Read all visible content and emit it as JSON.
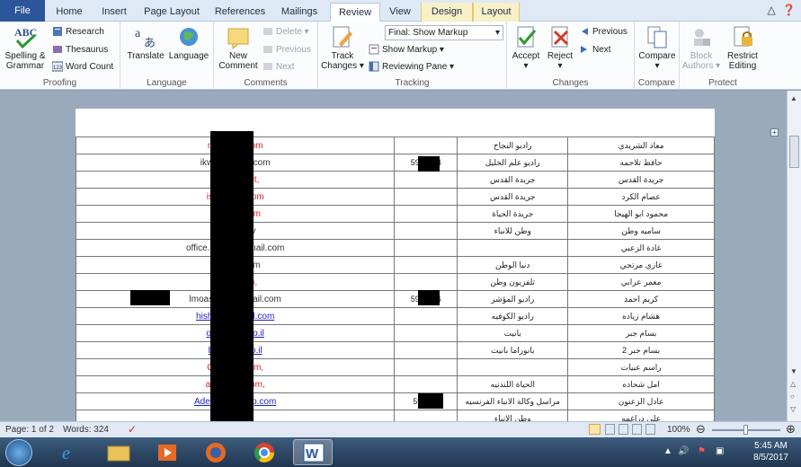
{
  "tabs": {
    "file": "File",
    "home": "Home",
    "insert": "Insert",
    "page_layout": "Page Layout",
    "references": "References",
    "mailings": "Mailings",
    "review": "Review",
    "view": "View",
    "design": "Design",
    "layout": "Layout"
  },
  "ribbon": {
    "proofing": {
      "label": "Proofing",
      "spelling_line1": "Spelling &",
      "spelling_line2": "Grammar",
      "research": "Research",
      "thesaurus": "Thesaurus",
      "word_count": "Word Count"
    },
    "language": {
      "label": "Language",
      "translate": "Translate",
      "language": "Language"
    },
    "comments": {
      "label": "Comments",
      "new_line1": "New",
      "new_line2": "Comment",
      "delete": "Delete",
      "previous": "Previous",
      "next": "Next"
    },
    "tracking": {
      "label": "Tracking",
      "track_line1": "Track",
      "track_line2": "Changes",
      "markup_mode": "Final: Show Markup",
      "show_markup": "Show Markup",
      "reviewing_pane": "Reviewing Pane"
    },
    "changes": {
      "label": "Changes",
      "accept": "Accept",
      "reject": "Reject",
      "previous": "Previous",
      "next": "Next"
    },
    "compare": {
      "label": "Compare",
      "compare": "Compare"
    },
    "protect": {
      "label": "Protect",
      "block_line1": "Block",
      "block_line2": "Authors",
      "restrict_line1": "Restrict",
      "restrict_line2": "Editing"
    }
  },
  "table_rows": [
    {
      "email": "moaz…o.com",
      "email_style": "red",
      "phone": "",
      "org": "راديو النجاح",
      "name": "معاذ الشريدي"
    },
    {
      "email": "ikwani…mail.com",
      "email_style": "dark",
      "phone": "59…334",
      "org": "راديو علم الخليل",
      "name": "حافظ تلاحمه"
    },
    {
      "email": "alqu…s.net,",
      "email_style": "red",
      "phone": "",
      "org": "جريدة القدس",
      "name": "جريدة القدس"
    },
    {
      "email": "isam_…o.com",
      "email_style": "red",
      "phone": "",
      "org": "جريدة القدس",
      "name": "عصام الكرد"
    },
    {
      "email": "mab…o.com",
      "email_style": "red",
      "phone": "",
      "org": "جريدة الحياة",
      "name": "محمود ابو الهيجا"
    },
    {
      "email": "sar…an.tv",
      "email_style": "dark",
      "phone": "",
      "org": "وطن للانباء",
      "name": "ساميه وطن"
    },
    {
      "email": "office.mar…@gmail.com",
      "email_style": "dark",
      "phone": "",
      "org": "",
      "name": "غادة الزعبي"
    },
    {
      "email": "gmo…il.com",
      "email_style": "dark",
      "phone": "",
      "org": "دنيا الوطن",
      "name": "غازي مرتجي"
    },
    {
      "email": "orabi…om,",
      "email_style": "red",
      "phone": "",
      "org": "تلفزيون وطن",
      "name": "معمر عرابي"
    },
    {
      "email": "lmoasher88.…nail.com",
      "email_style": "dark",
      "phone": "59…296",
      "org": "راديو المؤشر",
      "name": "كريم احمد"
    },
    {
      "email": "hishamz…mail.com",
      "email_style": "blue",
      "phone": "",
      "org": "راديو الكوفيه",
      "name": "هشام زياده"
    },
    {
      "email": "opera…et.co.il",
      "email_style": "blue",
      "phone": "",
      "org": "بانيت",
      "name": "بسام جبر"
    },
    {
      "email": "bass…et.co.il",
      "email_style": "blue",
      "phone": "",
      "org": "بانوراما بانيت",
      "name": "بسام جبر 2"
    },
    {
      "email": "Quds…il.com,",
      "email_style": "red",
      "phone": "",
      "org": "",
      "name": "راسم عبيات"
    },
    {
      "email": "amal2…il.com,",
      "email_style": "red",
      "phone": "",
      "org": "الحياة اللندنيه",
      "name": "امل شحاده"
    },
    {
      "email": "Adel.ZA…@afp.com",
      "email_style": "blue",
      "phone": "59…25",
      "org": "مراسل وكالة الانباء الفرنسيه",
      "name": "عادل الزعنون"
    },
    {
      "email": "dra…",
      "email_style": "red",
      "phone": "",
      "org": "وطن الانباء",
      "name": "علي دراغمه"
    }
  ],
  "status_bar": {
    "page": "Page: 1 of 2",
    "words": "Words: 324",
    "zoom": "100%"
  },
  "taskbar": {
    "time": "5:45 AM",
    "date": "8/5/2017"
  }
}
